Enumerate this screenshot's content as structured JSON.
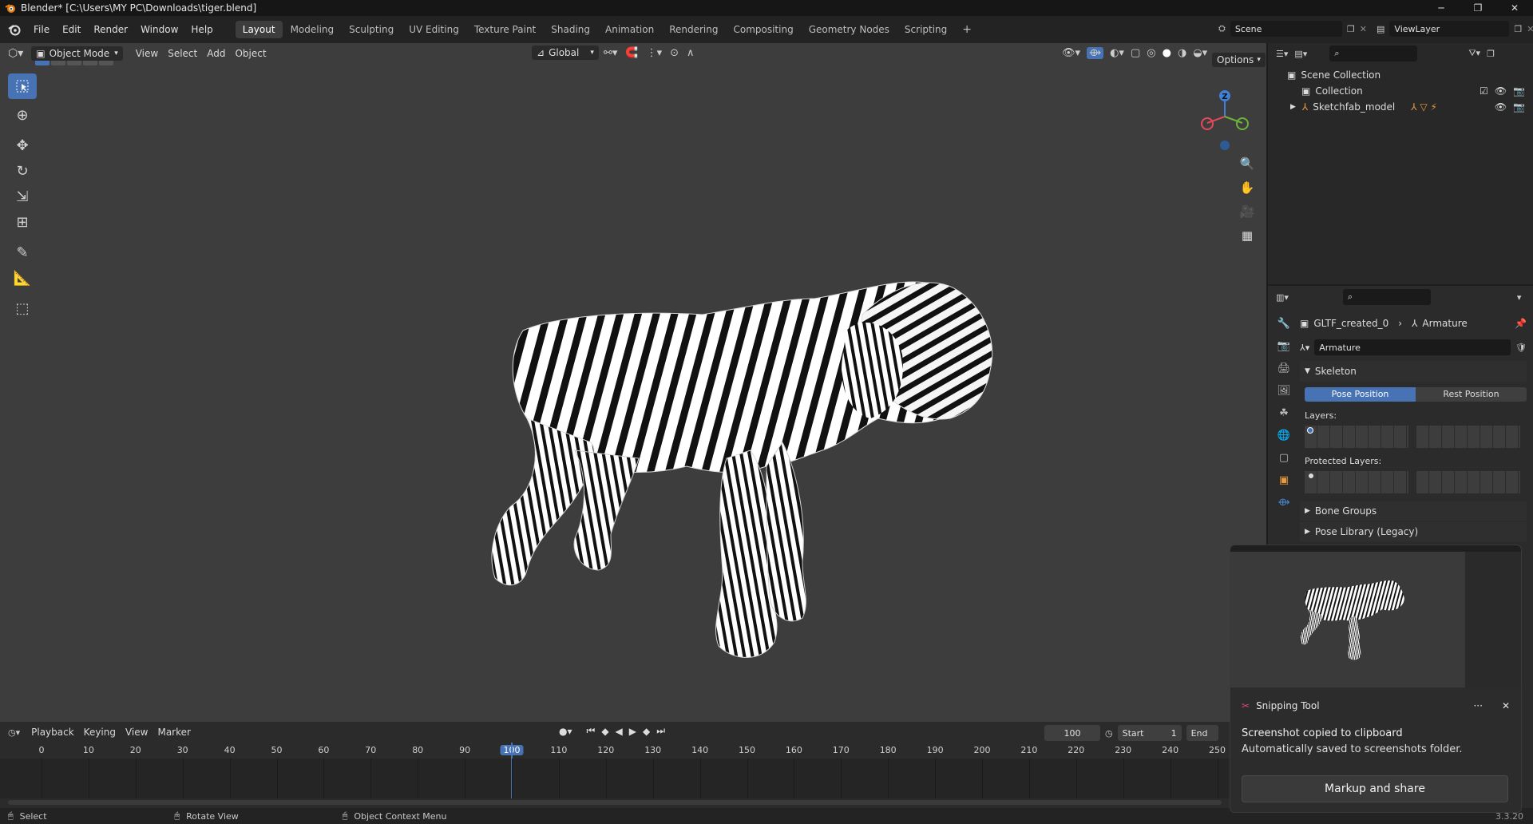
{
  "title": "Blender* [C:\\Users\\MY PC\\Downloads\\tiger.blend]",
  "window_buttons": [
    "─",
    "❐",
    "✕"
  ],
  "menu": [
    "File",
    "Edit",
    "Render",
    "Window",
    "Help"
  ],
  "workspaces": [
    "Layout",
    "Modeling",
    "Sculpting",
    "UV Editing",
    "Texture Paint",
    "Shading",
    "Animation",
    "Rendering",
    "Compositing",
    "Geometry Nodes",
    "Scripting"
  ],
  "add_workspace": "+",
  "scene_name": "Scene",
  "view_layer": "ViewLayer",
  "viewport": {
    "mode": "Object Mode",
    "menus": [
      "View",
      "Select",
      "Add",
      "Object"
    ],
    "transform_orientation": "Global",
    "options_label": "Options"
  },
  "gizmo": {
    "z_label": "Z"
  },
  "outliner": {
    "scene_collection": "Scene Collection",
    "collection": "Collection",
    "object": "Sketchfab_model"
  },
  "properties": {
    "breadcrumb_object": "GLTF_created_0",
    "breadcrumb_data": "Armature",
    "datablock": "Armature",
    "skeleton_title": "Skeleton",
    "pose_position": "Pose Position",
    "rest_position": "Rest Position",
    "layers_label": "Layers:",
    "protected_layers_label": "Protected Layers:",
    "bone_groups": "Bone Groups",
    "pose_library": "Pose Library (Legacy)"
  },
  "timeline": {
    "menus": [
      "Playback",
      "Keying",
      "View",
      "Marker"
    ],
    "current_frame": "100",
    "start_label": "Start",
    "start_value": "1",
    "end_label": "End",
    "ticks": [
      "0",
      "10",
      "20",
      "30",
      "40",
      "50",
      "60",
      "70",
      "80",
      "90",
      "100",
      "110",
      "120",
      "130",
      "140",
      "150",
      "160",
      "170",
      "180",
      "190",
      "200",
      "210",
      "220",
      "230",
      "240",
      "250"
    ],
    "playhead_frame": 100
  },
  "status": {
    "select": "Select",
    "rotate_view": "Rotate View",
    "context_menu": "Object Context Menu",
    "version": "3.3.20"
  },
  "toast": {
    "app_name": "Snipping Tool",
    "line1": "Screenshot copied to clipboard",
    "line2": "Automatically saved to screenshots folder.",
    "button": "Markup and share",
    "more": "···",
    "close": "✕"
  },
  "colors": {
    "accent": "#4772b3",
    "viewport_bg": "#3d3d3d",
    "panel_bg": "#2b2b2b",
    "axis_x": "#e44a5b",
    "axis_y": "#6bb33a",
    "axis_z": "#3f80d9"
  }
}
